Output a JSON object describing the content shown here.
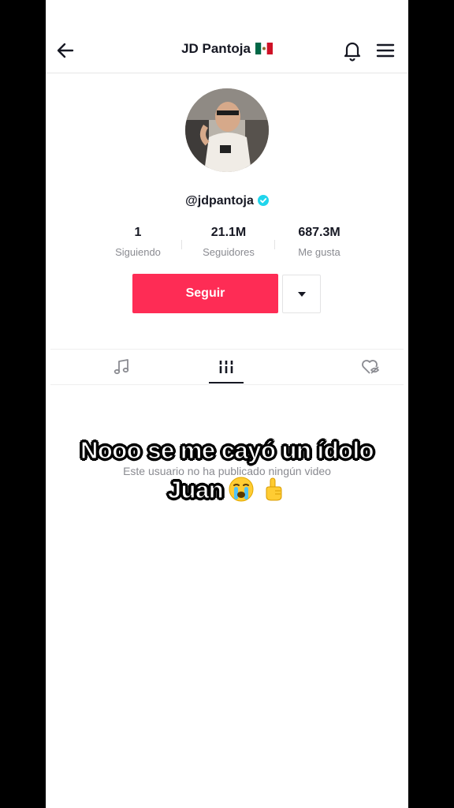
{
  "header": {
    "title": "JD Pantoja",
    "flag_emoji_name": "mexico-flag-icon"
  },
  "profile": {
    "username": "@jdpantoja",
    "verified": true,
    "avatar_icon": "profile-photo"
  },
  "stats": [
    {
      "value": "1",
      "label": "Siguiendo"
    },
    {
      "value": "21.1M",
      "label": "Seguidores"
    },
    {
      "value": "687.3M",
      "label": "Me gusta"
    }
  ],
  "actions": {
    "follow_label": "Seguir",
    "more_icon": "caret-down-icon"
  },
  "tabs": [
    {
      "icon": "music-note-icon"
    },
    {
      "icon": "grid-icon",
      "active": true
    },
    {
      "icon": "liked-hidden-icon"
    }
  ],
  "empty_state": "Este usuario no ha publicado ningún video",
  "overlay_caption": {
    "line1": "Nooo se me cayó un ídolo",
    "line2": "Juan",
    "emojis": [
      "crying-face-emoji",
      "pointing-up-emoji"
    ]
  },
  "colors": {
    "accent": "#fe2c55",
    "verified": "#20d5ec",
    "text_primary": "#161823",
    "text_secondary": "#8a8b91"
  }
}
